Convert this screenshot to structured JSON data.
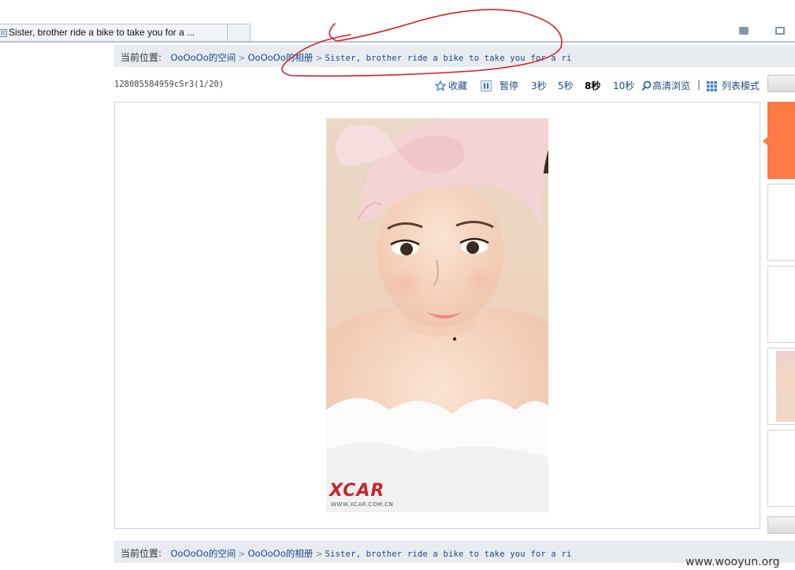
{
  "browser": {
    "tab_title": "Sister, brother ride a bike to take you for a ..."
  },
  "breadcrumb": {
    "prefix": "当前位置:",
    "items": [
      "OoOoOo的空间",
      "OoOoOo的相册",
      "Sister, brother ride a bike to take you for a ri"
    ],
    "separator": ">"
  },
  "photo_info": {
    "code": "128085584959cSr3",
    "position": "(1/20)"
  },
  "toolbar": {
    "favorite": "收藏",
    "pause": "暂停",
    "speed_3": "3秒",
    "speed_5": "5秒",
    "speed_8": "8秒",
    "speed_10": "10秒",
    "hd_view": "高清浏览",
    "list_mode": "列表模式"
  },
  "watermark": {
    "logo": "XCAR",
    "url": "WWW.XCAR.COM.CN"
  },
  "site_watermark": "www.wooyun.org",
  "colors": {
    "link": "#174a8b",
    "active_thumb": "#ff7a45",
    "annotation": "#d42020",
    "logo_red": "#c8242b"
  },
  "icons": {
    "favorite": "star-icon",
    "pause": "pause-icon",
    "hd": "magnifier-icon",
    "list": "grid-icon"
  }
}
